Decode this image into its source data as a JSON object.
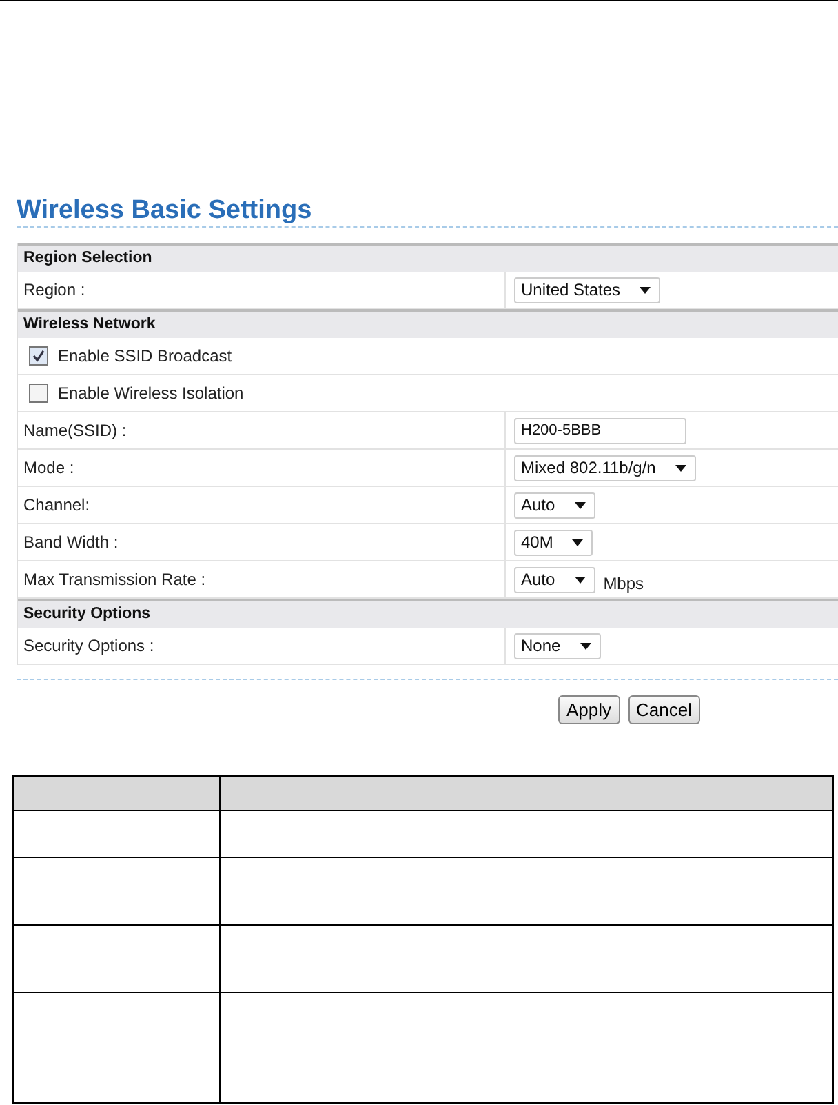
{
  "title": "Wireless Basic Settings",
  "sections": [
    {
      "heading": "Region Selection",
      "rows": [
        {
          "kind": "select",
          "label": "Region :",
          "value": "United States"
        }
      ]
    },
    {
      "heading": "Wireless Network",
      "rows": [
        {
          "kind": "checkbox",
          "label": "Enable SSID Broadcast",
          "checked": true
        },
        {
          "kind": "checkbox",
          "label": "Enable Wireless Isolation",
          "checked": false
        },
        {
          "kind": "text",
          "label": "Name(SSID) :",
          "value": "H200-5BBB"
        },
        {
          "kind": "select",
          "label": "Mode :",
          "value": "Mixed 802.11b/g/n"
        },
        {
          "kind": "select",
          "label": "Channel:",
          "value": "Auto"
        },
        {
          "kind": "select",
          "label": "Band Width :",
          "value": "40M"
        },
        {
          "kind": "select",
          "label": "Max Transmission Rate :",
          "value": "Auto",
          "unit": "Mbps"
        }
      ]
    },
    {
      "heading": "Security Options",
      "rows": [
        {
          "kind": "select",
          "label": "Security Options :",
          "value": "None"
        }
      ]
    }
  ],
  "buttons": [
    "Apply",
    "Cancel"
  ]
}
